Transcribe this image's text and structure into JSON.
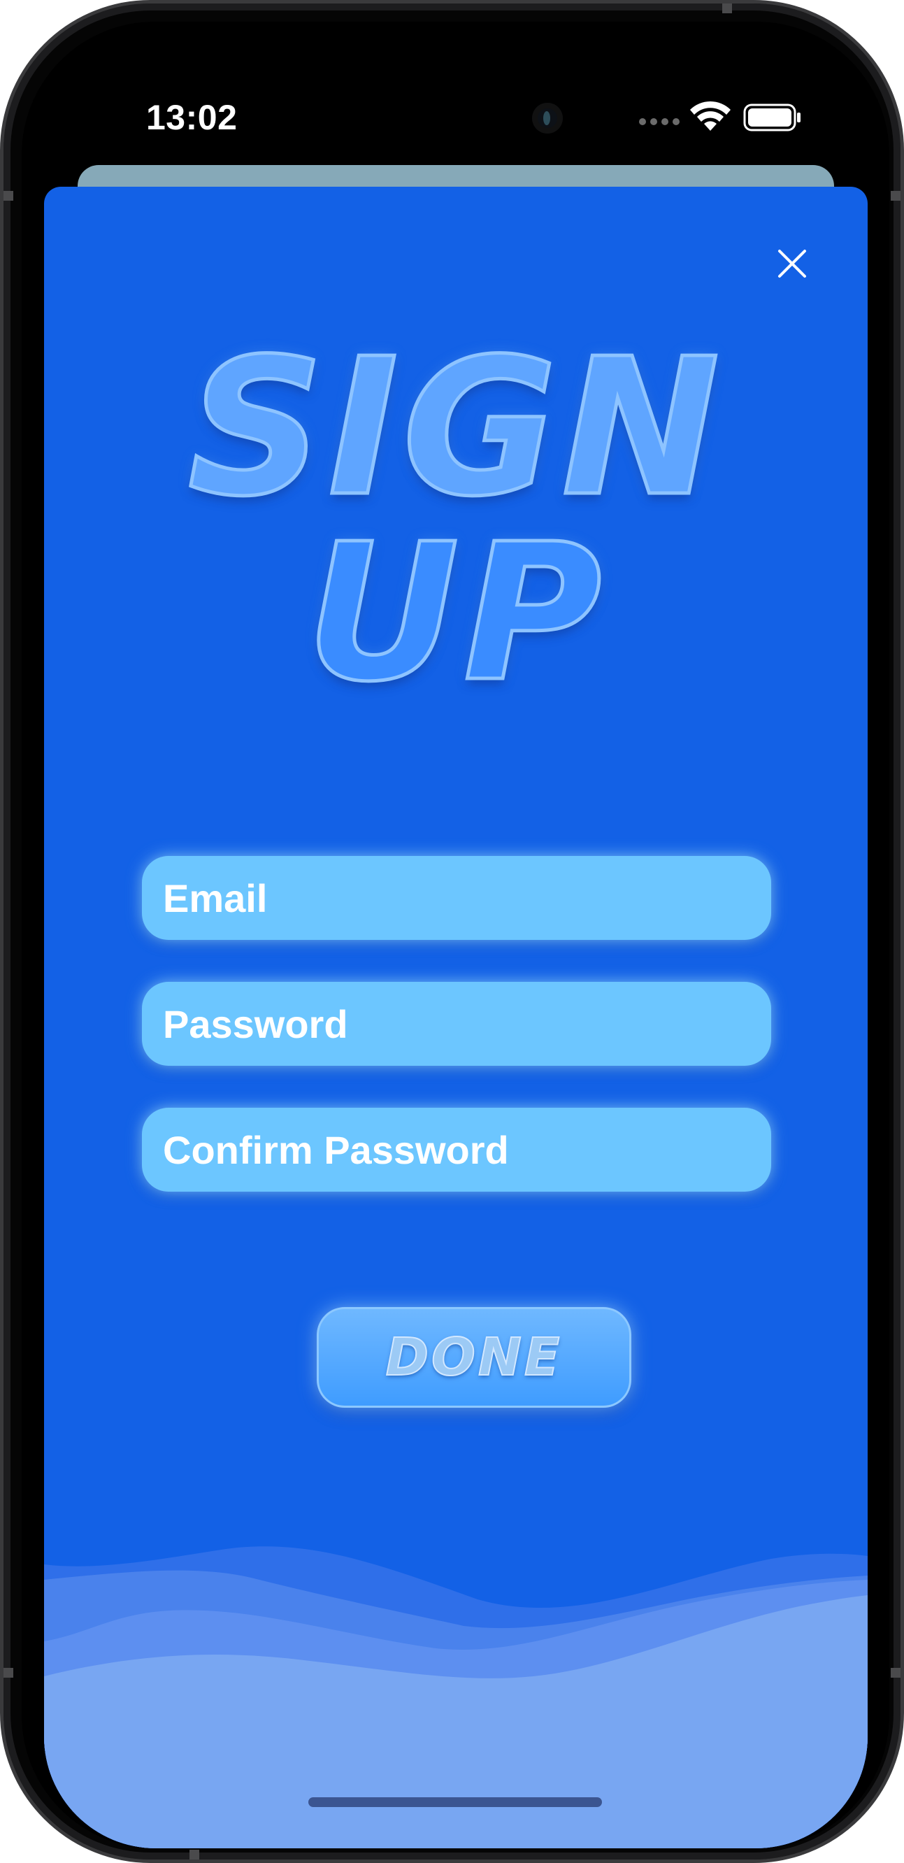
{
  "status_bar": {
    "time": "13:02"
  },
  "sheet": {
    "background_color": "#1361e6",
    "close_icon": "close-icon",
    "title_line_1": "SIGN",
    "title_line_2": "UP",
    "fields": {
      "email_placeholder": "Email",
      "password_placeholder": "Password",
      "confirm_password_placeholder": "Confirm Password"
    },
    "done_label": "DONE"
  },
  "colors": {
    "field_fill": "#6cc6ff",
    "wave_light": "#78a6f2",
    "title_fill": "#5fa5ff"
  },
  "icons": [
    "wifi-icon",
    "battery-icon",
    "cellular-signal-icon",
    "front-camera-icon",
    "close-icon"
  ]
}
